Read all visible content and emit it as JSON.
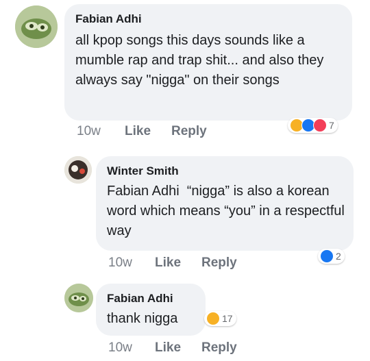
{
  "comments": [
    {
      "author": "Fabian Adhi",
      "text": "all kpop songs this days sounds like a mumble rap and trap shit... and also they always say \"nigga\" on their songs",
      "time": "10w",
      "like_label": "Like",
      "reply_label": "Reply",
      "reactions": {
        "icons": [
          "haha-icon",
          "like-icon",
          "love-icon"
        ],
        "count": "7"
      }
    },
    {
      "author": "Winter Smith",
      "mention": "Fabian Adhi",
      "text": "“nigga” is also a korean word which means “you” in a respectful way",
      "time": "10w",
      "like_label": "Like",
      "reply_label": "Reply",
      "reactions": {
        "icons": [
          "like-icon"
        ],
        "count": "2"
      }
    },
    {
      "author": "Fabian Adhi",
      "text": "thank nigga",
      "time": "10w",
      "like_label": "Like",
      "reply_label": "Reply",
      "reactions": {
        "icons": [
          "haha-icon"
        ],
        "count": "17"
      }
    }
  ],
  "colors": {
    "bubble": "#f0f2f5",
    "like_blue": "#1877f2",
    "love_red": "#f33e58",
    "haha_yellow": "#f7b125",
    "meta_gray": "#7a7f87"
  }
}
